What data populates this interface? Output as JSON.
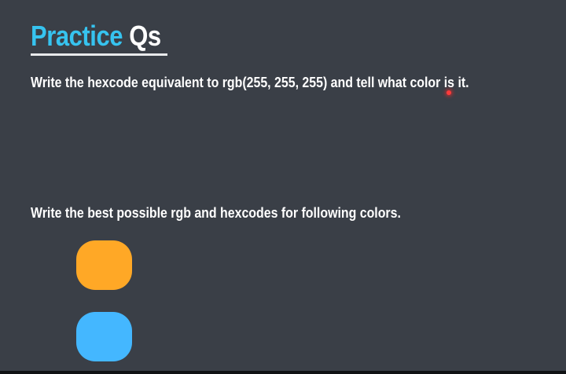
{
  "slide": {
    "title_accent": "Practice",
    "title_rest": "Qs",
    "question_1": "Write the hexcode equivalent to rgb(255, 255, 255) and tell what color is it.",
    "question_2": "Write the best possible rgb and hexcodes for following colors.",
    "swatches": [
      {
        "color": "#ffa826"
      },
      {
        "color": "#44b7ff"
      }
    ]
  },
  "colors": {
    "background": "#3a3f47",
    "title_accent": "#36c3ef",
    "text": "#ffffff",
    "laser_pointer": "#ff3b3b"
  }
}
